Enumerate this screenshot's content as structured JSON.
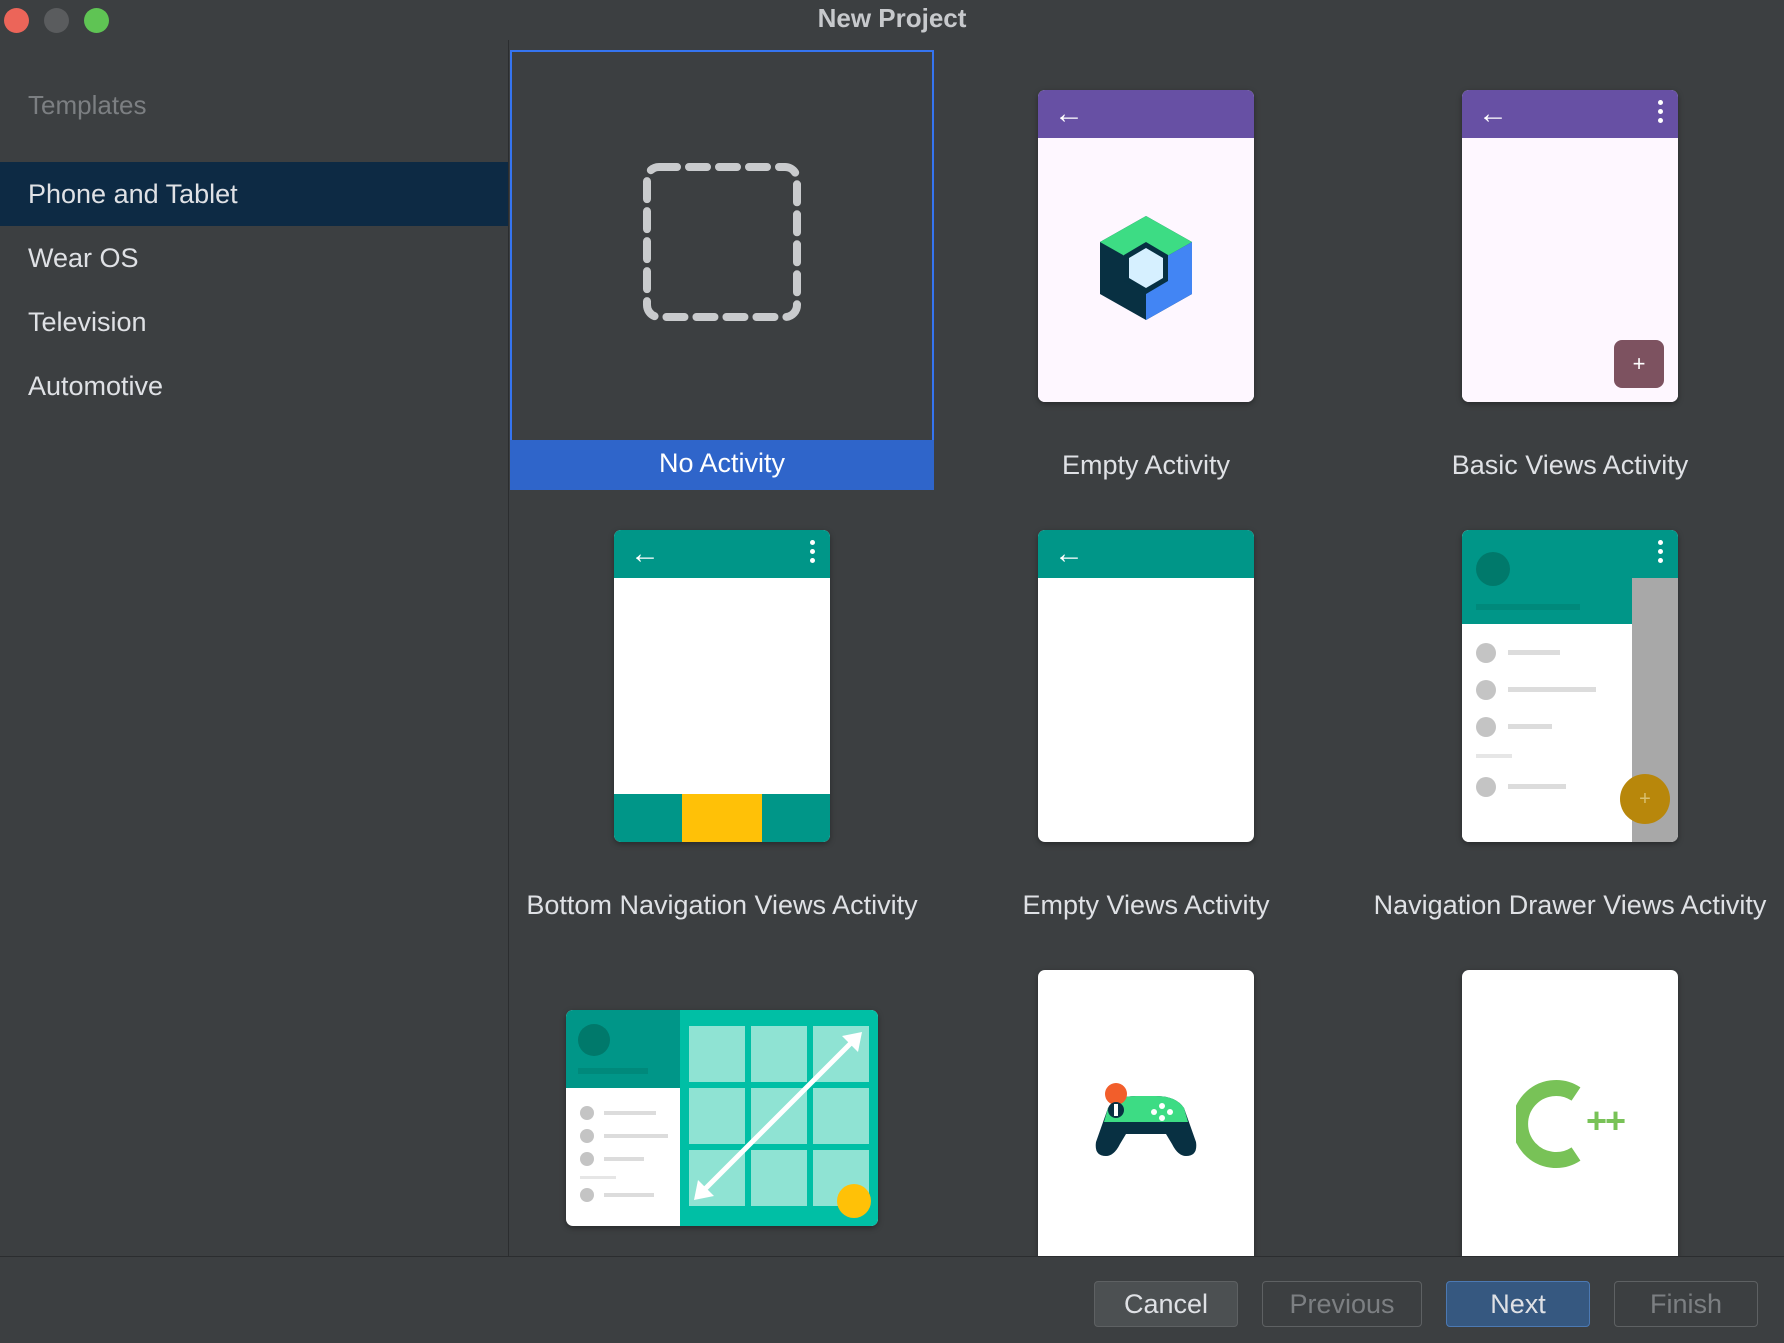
{
  "window": {
    "title": "New Project"
  },
  "sidebar": {
    "header": "Templates",
    "items": [
      {
        "label": "Phone and Tablet",
        "selected": true
      },
      {
        "label": "Wear OS"
      },
      {
        "label": "Television"
      },
      {
        "label": "Automotive"
      }
    ]
  },
  "templates": [
    {
      "label": "No Activity",
      "selected": true
    },
    {
      "label": "Empty Activity"
    },
    {
      "label": "Basic Views Activity"
    },
    {
      "label": "Bottom Navigation Views Activity"
    },
    {
      "label": "Empty Views Activity"
    },
    {
      "label": "Navigation Drawer Views Activity"
    },
    {
      "label": ""
    },
    {
      "label": ""
    },
    {
      "label": ""
    }
  ],
  "icons": {
    "cpp_text": "C++",
    "fab_plus": "+"
  },
  "colors": {
    "purple_appbar": "#6750a4",
    "teal": "#009688",
    "amber": "#ffc107",
    "selection_blue": "#2f65ca"
  },
  "footer": {
    "cancel": "Cancel",
    "previous": "Previous",
    "next": "Next",
    "finish": "Finish"
  }
}
